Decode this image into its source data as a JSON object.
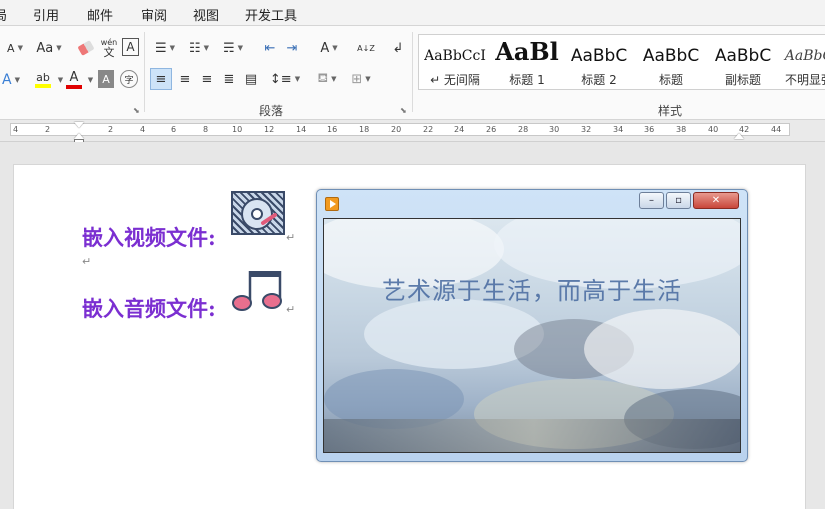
{
  "tabs": [
    "引用",
    "邮件",
    "审阅",
    "视图",
    "开发工具"
  ],
  "tab_partial": "局",
  "ribbon": {
    "font_small_a": "A",
    "font_grow": "Aa",
    "pinyin_top": "wén",
    "pinyin_bottom": "文",
    "char_border": "A",
    "font_color_a": "A",
    "char_shade": "A",
    "enclose_char": "字",
    "sort_label": "A↓Z",
    "change_case": "A"
  },
  "styles_gallery": {
    "items": [
      {
        "sample": "AaBbCcI",
        "name": "↵ 无间隔"
      },
      {
        "sample": "AaBl",
        "name": "标题 1"
      },
      {
        "sample": "AaBbC",
        "name": "标题 2"
      },
      {
        "sample": "AaBbC",
        "name": "标题"
      },
      {
        "sample": "AaBbC",
        "name": "副标题"
      },
      {
        "sample": "AaBbC",
        "name": "不明显强"
      }
    ]
  },
  "group_labels": {
    "paragraph": "段落",
    "styles": "样式"
  },
  "ruler": {
    "labels": [
      "4",
      "2",
      "2",
      "4",
      "6",
      "8",
      "10",
      "12",
      "14",
      "16",
      "18",
      "20",
      "22",
      "24",
      "26",
      "28",
      "30",
      "32",
      "34",
      "36",
      "38",
      "40",
      "42",
      "44"
    ]
  },
  "document": {
    "video_line": "嵌入视频文件:",
    "audio_line": "嵌入音频文件:",
    "pilcrow": "↵"
  },
  "player": {
    "caption": "艺术源于生活，而高于生活",
    "buttons": {
      "minimize": "–",
      "maximize": "▫",
      "close": "✕"
    }
  },
  "colors": {
    "heading_text": "#7b2fd1",
    "highlight": "#ffff00",
    "font_color": "#e00000",
    "close_button": "#c9463a"
  }
}
